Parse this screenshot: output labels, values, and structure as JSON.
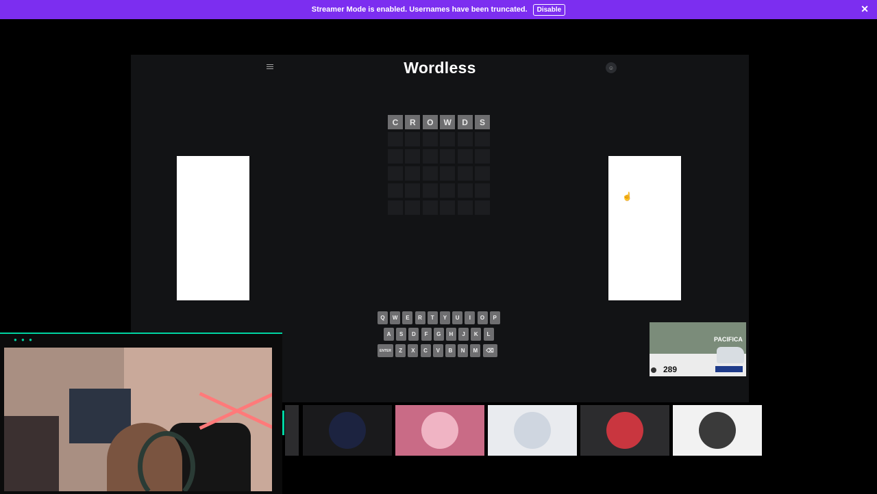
{
  "banner": {
    "message": "Streamer Mode is enabled. Usernames have been truncated.",
    "button_label": "Disable",
    "close_glyph": "✕",
    "background": "#7c2ef0"
  },
  "game": {
    "title": "Wordless",
    "menu_icon": "hamburger-menu-icon",
    "user_icon": "user-icon",
    "user_glyph": "☺",
    "guesses": [
      [
        "C",
        "R",
        "O",
        "W",
        "D",
        "S"
      ],
      [
        "",
        "",
        "",
        "",
        "",
        ""
      ],
      [
        "",
        "",
        "",
        "",
        "",
        ""
      ],
      [
        "",
        "",
        "",
        "",
        "",
        ""
      ],
      [
        "",
        "",
        "",
        "",
        "",
        ""
      ],
      [
        "",
        "",
        "",
        "",
        "",
        ""
      ]
    ],
    "keyboard": {
      "row1": [
        "Q",
        "W",
        "E",
        "R",
        "T",
        "Y",
        "U",
        "I",
        "O",
        "P"
      ],
      "row2": [
        "A",
        "S",
        "D",
        "F",
        "G",
        "H",
        "J",
        "K",
        "L"
      ],
      "row3": [
        "ENTER",
        "Z",
        "X",
        "C",
        "V",
        "B",
        "N",
        "M",
        "⌫"
      ]
    }
  },
  "video_ad": {
    "brand": "PACIFICA",
    "price": "289"
  },
  "thumbnails": [
    {
      "name": "thumb-galaxy",
      "bg": "#1a1a1c",
      "circle": "#1c2340"
    },
    {
      "name": "thumb-pink-avatar",
      "bg": "#c96b86",
      "circle": "#f0b4c4"
    },
    {
      "name": "thumb-yankees-logo",
      "bg": "#e9ebef",
      "circle": "#cfd6e0"
    },
    {
      "name": "thumb-red-figure",
      "bg": "#2c2c2e",
      "circle": "#c9363f"
    },
    {
      "name": "thumb-silhouette",
      "bg": "#f2f2f2",
      "circle": "#3a3a3a"
    }
  ]
}
